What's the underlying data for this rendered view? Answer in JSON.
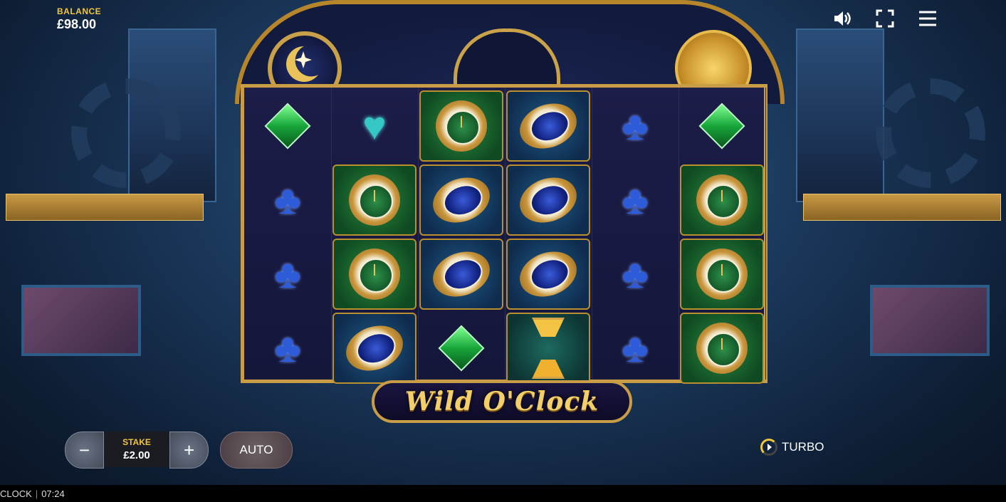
{
  "balance": {
    "label": "BALANCE",
    "value": "£98.00"
  },
  "top_icons": [
    "speaker-icon",
    "fullscreen-icon",
    "menu-icon"
  ],
  "game": {
    "title": "Wild O'Clock",
    "grid": [
      [
        "green-diamond",
        "blue-club",
        "blue-club",
        "blue-club"
      ],
      [
        "teal-heart",
        "green-watch",
        "green-watch",
        "blue-watch"
      ],
      [
        "green-watch",
        "blue-watch",
        "blue-watch",
        "green-diamond"
      ],
      [
        "blue-watch",
        "blue-watch",
        "blue-watch",
        "hourglass"
      ],
      [
        "blue-club",
        "blue-club",
        "blue-club",
        "blue-club"
      ],
      [
        "green-diamond",
        "green-watch",
        "green-watch",
        "green-watch"
      ]
    ]
  },
  "controls": {
    "minus": "−",
    "stake_label": "STAKE",
    "stake_value": "£2.00",
    "plus": "+",
    "auto": "AUTO",
    "turbo": "TURBO"
  },
  "footer": {
    "name": "CLOCK",
    "time": "07:24"
  },
  "colors": {
    "accent_gold": "#f0c640",
    "frame_gold": "#c99d46"
  }
}
